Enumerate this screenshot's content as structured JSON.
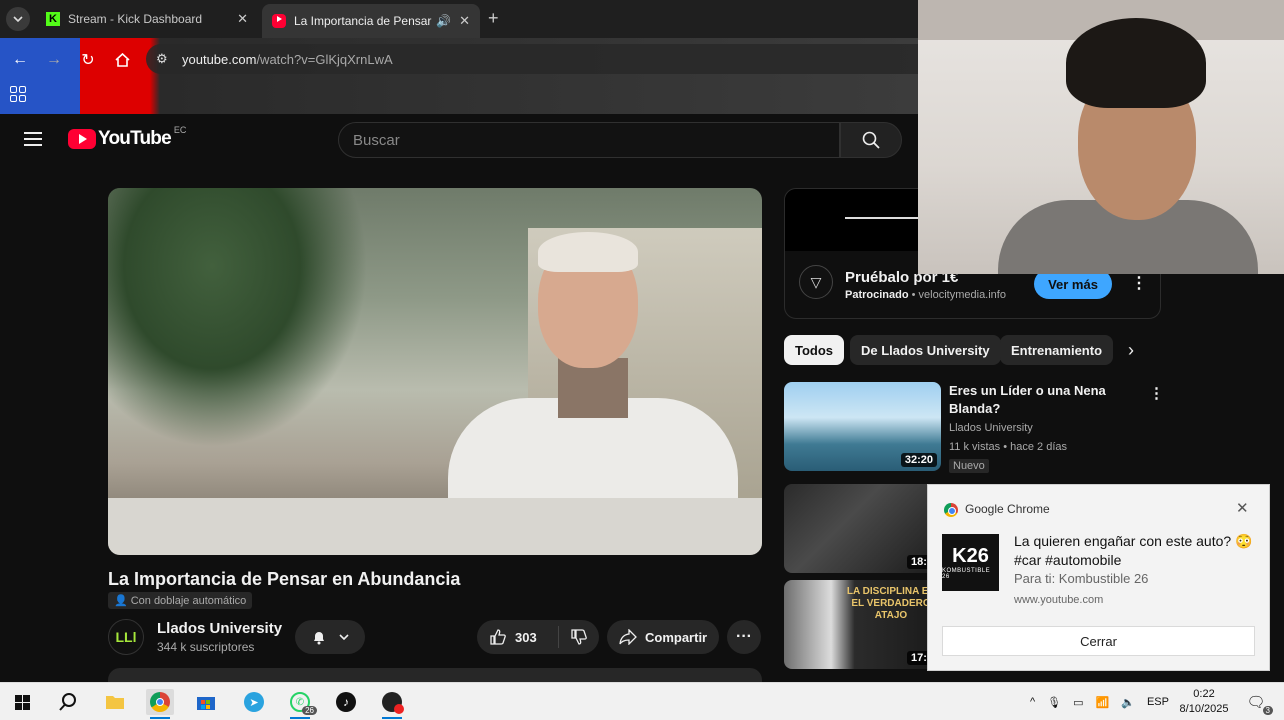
{
  "browser": {
    "tabs": [
      {
        "title": "Stream - Kick Dashboard",
        "active": false
      },
      {
        "title": "La Importancia de Pensar en",
        "active": true
      }
    ],
    "url_domain": "youtube.com",
    "url_path": "/watch?v=GlKjqXrnLwA"
  },
  "youtube": {
    "logo_text": "YouTube",
    "country_code": "EC",
    "search_placeholder": "Buscar"
  },
  "video": {
    "title": "La Importancia de Pensar en Abundancia",
    "dub_label": "Con doblaje automático",
    "channel": {
      "avatar_text": "LLl",
      "name": "Llados University",
      "subscribers": "344 k suscriptores"
    },
    "likes": "303",
    "share_label": "Compartir"
  },
  "ad": {
    "title": "Pruébalo por 1€",
    "sponsored_label": "Patrocinado",
    "domain": "velocitymedia.info",
    "cta": "Ver más"
  },
  "chips": [
    "Todos",
    "De Llados University",
    "Entrenamiento"
  ],
  "recommendations": [
    {
      "title": "Eres un Líder o una Nena Blanda?",
      "channel": "Llados University",
      "stats": "11 k vistas • hace 2 días",
      "badge": "Nuevo",
      "duration": "32:20"
    },
    {
      "title": "",
      "channel": "",
      "stats": "",
      "badge": "",
      "duration": "18:3"
    },
    {
      "title": "",
      "channel": "",
      "stats": "",
      "badge": "",
      "duration": "17:3",
      "thumb_text": "LA DISCIPLINA ES EL VERDADERO ATAJO"
    }
  ],
  "notification": {
    "app": "Google Chrome",
    "icon_text": "K26",
    "icon_sub": "KOMBUSTIBLE 26",
    "title": "La quieren engañar con este auto? 😳 #car #automobile",
    "subtitle": "Para ti: Kombustible 26",
    "site": "www.youtube.com",
    "button": "Cerrar"
  },
  "taskbar": {
    "language": "ESP",
    "time": "0:22",
    "date": "8/10/2025",
    "whatsapp_badge": "26",
    "notification_count": "3"
  },
  "colors": {
    "youtube_red": "#ff0033",
    "accent_blue": "#3ea6ff",
    "background": "#0f0f0f"
  }
}
